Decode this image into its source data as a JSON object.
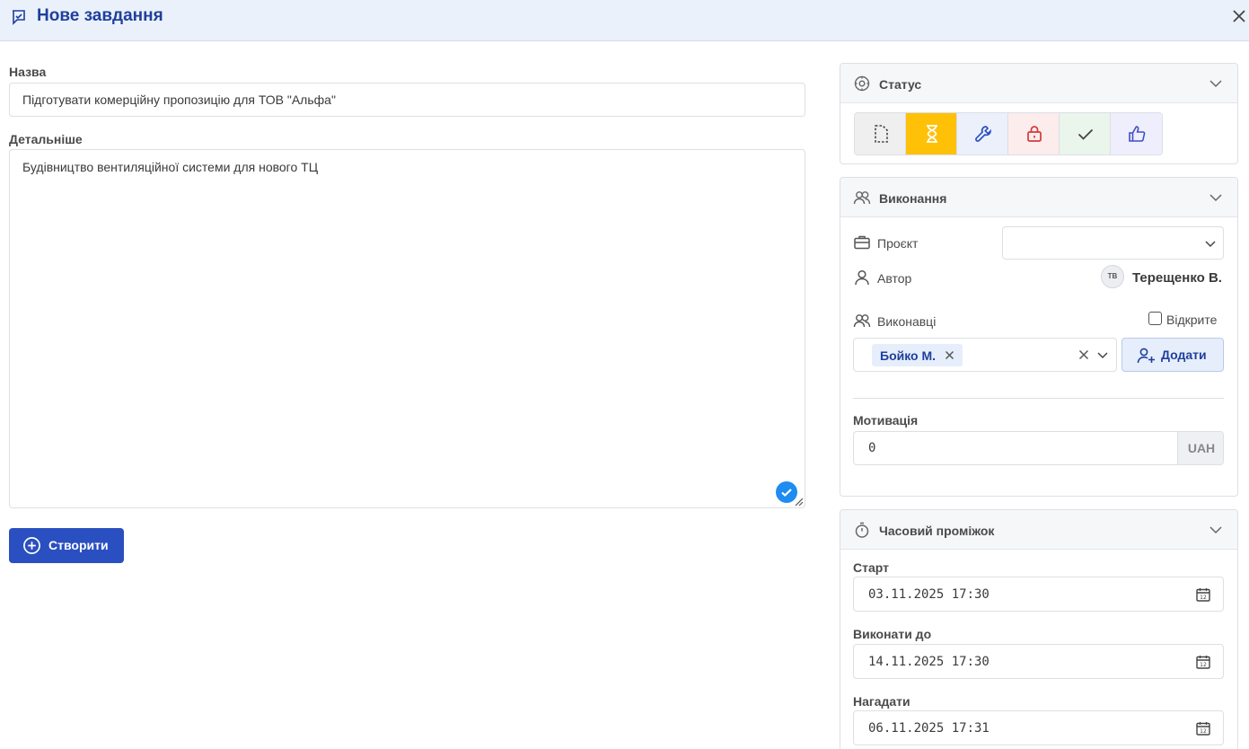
{
  "header": {
    "title": "Нове завдання"
  },
  "form": {
    "name_label": "Назва",
    "name_value": "Підготувати комерційну пропозицію для ТОВ \"Альфа\"",
    "details_label": "Детальніше",
    "details_value": "Будівництво вентиляційної системи для нового ТЦ",
    "create_label": "Створити"
  },
  "status": {
    "title": "Статус",
    "buttons": [
      {
        "name": "draft",
        "icon": "file-dashed-icon",
        "bg": "#efefef",
        "color": "#444444",
        "active": false
      },
      {
        "name": "waiting",
        "icon": "hourglass-icon",
        "bg": "#ffc107",
        "color": "#ffffff",
        "active": true
      },
      {
        "name": "in-progress",
        "icon": "wrench-icon",
        "bg": "#ecf0fb",
        "color": "#2a4fc0",
        "active": false
      },
      {
        "name": "blocked",
        "icon": "lock-icon",
        "bg": "#fcecec",
        "color": "#d33a3a",
        "active": false
      },
      {
        "name": "done",
        "icon": "check-icon",
        "bg": "#eaf5ec",
        "color": "#444444",
        "active": false
      },
      {
        "name": "approved",
        "icon": "thumbs-up-icon",
        "bg": "#efeefc",
        "color": "#3e4fc7",
        "active": false
      }
    ]
  },
  "execution": {
    "title": "Виконання",
    "project_label": "Проєкт",
    "project_value": "",
    "author_label": "Автор",
    "author_initials": "ТВ",
    "author_name": "Терещенко В.",
    "assignees_label": "Виконавці",
    "open_label": "Відкрите",
    "assignee_tag": "Бойко М.",
    "add_label": "Додати",
    "motivation_label": "Мотивація",
    "motivation_value": "0",
    "currency": "UAH"
  },
  "timeframe": {
    "title": "Часовий проміжок",
    "start_label": "Старт",
    "start_value": "03.11.2025 17:30",
    "due_label": "Виконати до",
    "due_value": "14.11.2025 17:30",
    "remind_label": "Нагадати",
    "remind_value": "06.11.2025 17:31"
  },
  "colors": {
    "accent": "#2a4fc0",
    "title": "#1f3f9c",
    "header_bg": "#eaf1fb",
    "check": "#1e8cf0"
  }
}
